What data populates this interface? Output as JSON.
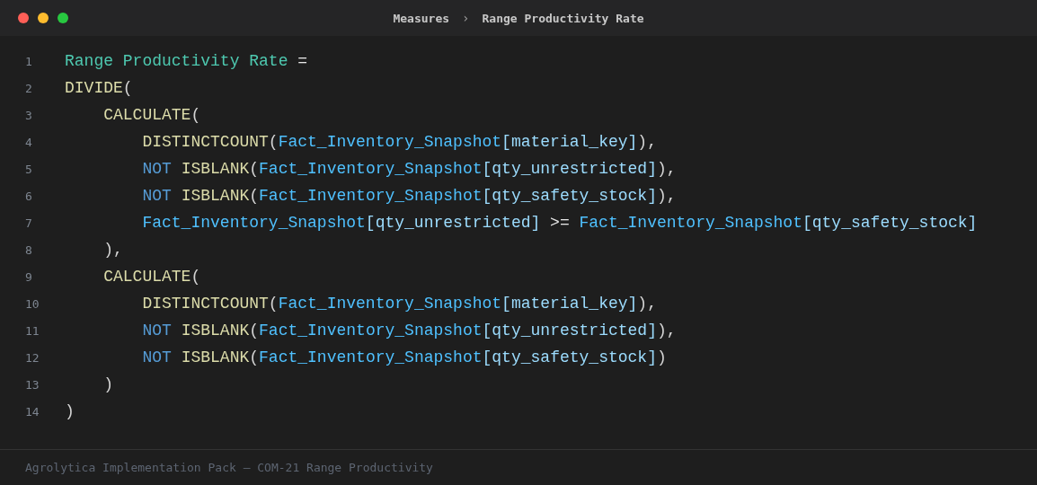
{
  "window": {
    "breadcrumb": [
      {
        "label": "Measures"
      },
      {
        "label": "›",
        "kind": "separator"
      },
      {
        "label": "Range Productivity Rate"
      }
    ]
  },
  "editor": {
    "lines": [
      {
        "number": "1",
        "tokens": [
          {
            "kind": "name",
            "text": "Range Productivity Rate"
          },
          {
            "kind": "op",
            "text": " ="
          }
        ]
      },
      {
        "number": "2",
        "tokens": [
          {
            "kind": "fn",
            "text": "DIVIDE"
          },
          {
            "kind": "punct",
            "text": "("
          }
        ]
      },
      {
        "number": "3",
        "tokens": [
          {
            "kind": "fn",
            "text": "    CALCULATE"
          },
          {
            "kind": "punct",
            "text": "("
          }
        ]
      },
      {
        "number": "4",
        "tokens": [
          {
            "kind": "fn",
            "text": "        DISTINCTCOUNT"
          },
          {
            "kind": "punct",
            "text": "("
          },
          {
            "kind": "table",
            "text": "Fact_Inventory_Snapshot"
          },
          {
            "kind": "col",
            "text": "[material_key]"
          },
          {
            "kind": "punct",
            "text": "),"
          }
        ]
      },
      {
        "number": "5",
        "tokens": [
          {
            "kind": "kw",
            "text": "        NOT "
          },
          {
            "kind": "fn",
            "text": "ISBLANK"
          },
          {
            "kind": "punct",
            "text": "("
          },
          {
            "kind": "table",
            "text": "Fact_Inventory_Snapshot"
          },
          {
            "kind": "col",
            "text": "[qty_unrestricted]"
          },
          {
            "kind": "punct",
            "text": "),"
          }
        ]
      },
      {
        "number": "6",
        "tokens": [
          {
            "kind": "kw",
            "text": "        NOT "
          },
          {
            "kind": "fn",
            "text": "ISBLANK"
          },
          {
            "kind": "punct",
            "text": "("
          },
          {
            "kind": "table",
            "text": "Fact_Inventory_Snapshot"
          },
          {
            "kind": "col",
            "text": "[qty_safety_stock]"
          },
          {
            "kind": "punct",
            "text": "),"
          }
        ]
      },
      {
        "number": "7",
        "tokens": [
          {
            "kind": "table",
            "text": "        Fact_Inventory_Snapshot"
          },
          {
            "kind": "col",
            "text": "[qty_unrestricted]"
          },
          {
            "kind": "op",
            "text": " >= "
          },
          {
            "kind": "table",
            "text": "Fact_Inventory_Snapshot"
          },
          {
            "kind": "col",
            "text": "[qty_safety_stock]"
          }
        ]
      },
      {
        "number": "8",
        "tokens": [
          {
            "kind": "punct",
            "text": "    ),"
          }
        ]
      },
      {
        "number": "9",
        "tokens": [
          {
            "kind": "fn",
            "text": "    CALCULATE"
          },
          {
            "kind": "punct",
            "text": "("
          }
        ]
      },
      {
        "number": "10",
        "tokens": [
          {
            "kind": "fn",
            "text": "        DISTINCTCOUNT"
          },
          {
            "kind": "punct",
            "text": "("
          },
          {
            "kind": "table",
            "text": "Fact_Inventory_Snapshot"
          },
          {
            "kind": "col",
            "text": "[material_key]"
          },
          {
            "kind": "punct",
            "text": "),"
          }
        ]
      },
      {
        "number": "11",
        "tokens": [
          {
            "kind": "kw",
            "text": "        NOT "
          },
          {
            "kind": "fn",
            "text": "ISBLANK"
          },
          {
            "kind": "punct",
            "text": "("
          },
          {
            "kind": "table",
            "text": "Fact_Inventory_Snapshot"
          },
          {
            "kind": "col",
            "text": "[qty_unrestricted]"
          },
          {
            "kind": "punct",
            "text": "),"
          }
        ]
      },
      {
        "number": "12",
        "tokens": [
          {
            "kind": "kw",
            "text": "        NOT "
          },
          {
            "kind": "fn",
            "text": "ISBLANK"
          },
          {
            "kind": "punct",
            "text": "("
          },
          {
            "kind": "table",
            "text": "Fact_Inventory_Snapshot"
          },
          {
            "kind": "col",
            "text": "[qty_safety_stock]"
          },
          {
            "kind": "punct",
            "text": ")"
          }
        ]
      },
      {
        "number": "13",
        "tokens": [
          {
            "kind": "punct",
            "text": "    )"
          }
        ]
      },
      {
        "number": "14",
        "tokens": [
          {
            "kind": "punct",
            "text": ")"
          }
        ]
      }
    ]
  },
  "footer": {
    "text": "Agrolytica Implementation Pack — COM-21 Range Productivity"
  }
}
